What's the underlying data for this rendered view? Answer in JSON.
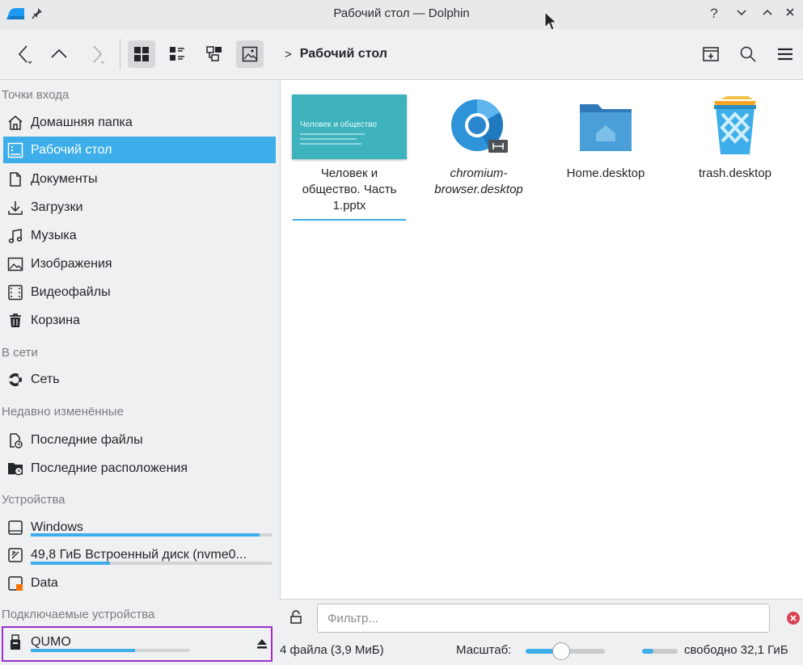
{
  "window": {
    "title": "Рабочий стол — Dolphin"
  },
  "titlebar_buttons": [
    "?",
    "⌄",
    "⌃",
    "×"
  ],
  "breadcrumb": {
    "arrow": ">",
    "current": "Рабочий стол"
  },
  "sidebar": {
    "sections": {
      "places": "Точки входа",
      "network": "В сети",
      "recent": "Недавно изменённые",
      "devices": "Устройства",
      "removable": "Подключаемые устройства"
    },
    "places": [
      {
        "label": "Домашняя папка",
        "icon": "home-icon"
      },
      {
        "label": "Рабочий стол",
        "icon": "desktop-icon",
        "selected": true
      },
      {
        "label": "Документы",
        "icon": "documents-icon"
      },
      {
        "label": "Загрузки",
        "icon": "downloads-icon"
      },
      {
        "label": "Музыка",
        "icon": "music-icon"
      },
      {
        "label": "Изображения",
        "icon": "pictures-icon"
      },
      {
        "label": "Видеофайлы",
        "icon": "videos-icon"
      },
      {
        "label": "Корзина",
        "icon": "trash-icon"
      }
    ],
    "network": [
      {
        "label": "Сеть",
        "icon": "network-icon"
      }
    ],
    "recent": [
      {
        "label": "Последние файлы",
        "icon": "recent-files-icon"
      },
      {
        "label": "Последние расположения",
        "icon": "recent-locations-icon"
      }
    ],
    "devices": [
      {
        "label": "Windows",
        "icon": "drive-icon",
        "usage": 0.95
      },
      {
        "label": "49,8 ГиБ Встроенный диск (nvme0...",
        "icon": "drive-icon",
        "usage": 0.33
      },
      {
        "label": "Data",
        "icon": "drive-icon"
      }
    ],
    "removable": [
      {
        "label": "QUMO",
        "icon": "usb-icon",
        "usage": 0.66
      }
    ]
  },
  "files": [
    {
      "name": "Человек и общество. Часть 1.pptx",
      "line1": "Человек и",
      "line2": "общество. Часть",
      "line3": "1.pptx",
      "thumb_title": "Человек и общество"
    },
    {
      "name": "chromium-browser.desktop",
      "line1": "chromium-",
      "line2": "browser.desktop"
    },
    {
      "name": "Home.desktop",
      "line1": "Home.desktop"
    },
    {
      "name": "trash.desktop",
      "line1": "trash.desktop"
    }
  ],
  "filter": {
    "placeholder": "Фильтр..."
  },
  "status": {
    "summary": "4 файла (3,9 МиБ)",
    "zoom_label": "Масштаб:",
    "zoom_level": 0.45,
    "free_space": "свободно 32,1 ГиБ"
  },
  "colors": {
    "accent": "#3daee9",
    "highlight_border": "#9b30c8",
    "close_red": "#da4453"
  }
}
